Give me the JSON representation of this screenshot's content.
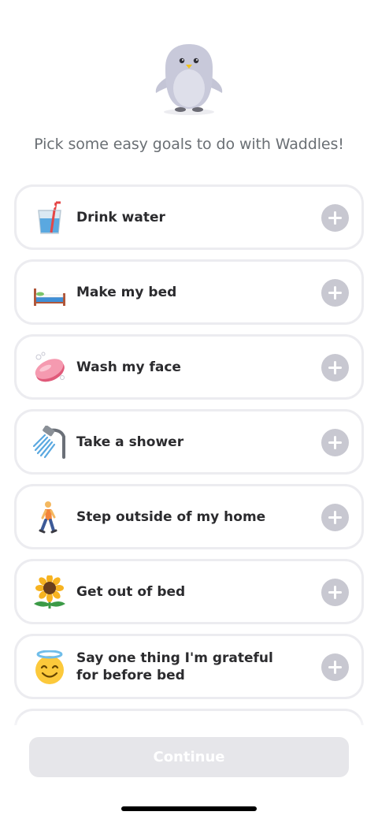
{
  "prompt": "Pick some easy goals to do with Waddles!",
  "goals": [
    {
      "label": "Drink water",
      "icon": "cup-with-straw-icon"
    },
    {
      "label": "Make my bed",
      "icon": "bed-icon"
    },
    {
      "label": "Wash my face",
      "icon": "soap-icon"
    },
    {
      "label": "Take a shower",
      "icon": "shower-icon"
    },
    {
      "label": "Step outside of my home",
      "icon": "person-walking-icon"
    },
    {
      "label": "Get out of bed",
      "icon": "sunflower-icon"
    },
    {
      "label": "Say one thing I'm grateful for before bed",
      "icon": "smiling-face-with-halo-icon"
    }
  ],
  "continue_label": "Continue",
  "colors": {
    "card_border": "#ececf0",
    "add_button": "#c8c8d1",
    "continue_disabled": "#e6e6ea",
    "text": "#2b2b2e",
    "prompt_text": "#6a6f74"
  }
}
